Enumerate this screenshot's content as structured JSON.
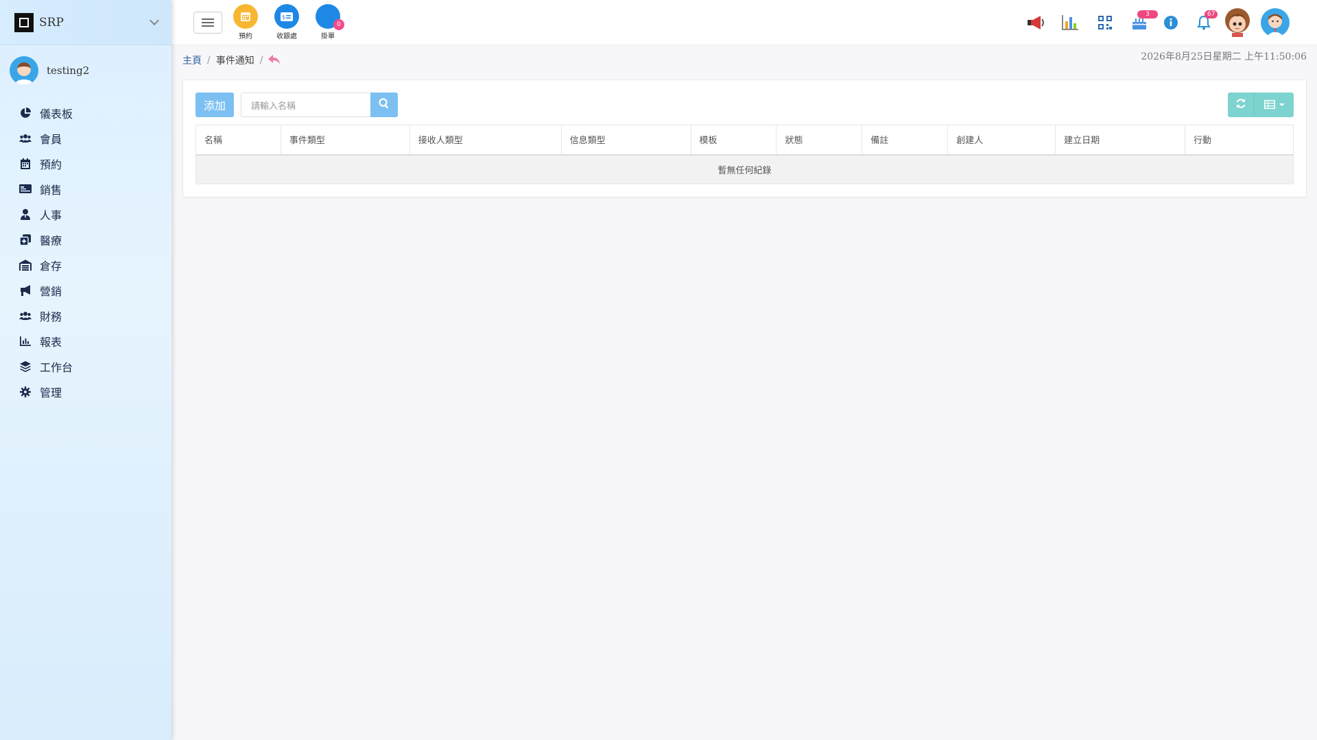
{
  "app": {
    "brand": "SRP"
  },
  "user": {
    "name": "testing2"
  },
  "sidebar": {
    "items": [
      {
        "label": "儀表板",
        "icon": "pie-chart-icon"
      },
      {
        "label": "會員",
        "icon": "users-icon"
      },
      {
        "label": "預約",
        "icon": "calendar-icon"
      },
      {
        "label": "銷售",
        "icon": "id-card-icon"
      },
      {
        "label": "人事",
        "icon": "user-tie-icon"
      },
      {
        "label": "醫療",
        "icon": "medical-clone-icon"
      },
      {
        "label": "倉存",
        "icon": "warehouse-icon"
      },
      {
        "label": "營銷",
        "icon": "bullhorn-icon"
      },
      {
        "label": "財務",
        "icon": "users-icon"
      },
      {
        "label": "報表",
        "icon": "bar-chart-icon"
      },
      {
        "label": "工作台",
        "icon": "layers-icon"
      },
      {
        "label": "管理",
        "icon": "gear-icon"
      }
    ]
  },
  "topbar": {
    "quick": [
      {
        "label": "預約",
        "color": "#f7b733",
        "icon": "calendar-icon"
      },
      {
        "label": "收銀處",
        "color": "#1e88e5",
        "icon": "cashier-card-icon"
      },
      {
        "label": "掛單",
        "color": "#1e88e5",
        "icon": "hang-order-icon",
        "badge": "0"
      }
    ],
    "right_icons": [
      {
        "icon": "megaphone-icon"
      },
      {
        "icon": "bar-chart-icon"
      },
      {
        "icon": "qr-code-icon"
      },
      {
        "icon": "cake-icon",
        "badge": "3"
      },
      {
        "icon": "info-icon"
      },
      {
        "icon": "bell-icon",
        "badge": "67"
      },
      {
        "icon": "girl-avatar-icon"
      },
      {
        "icon": "user-avatar-icon"
      }
    ]
  },
  "breadcrumb": {
    "home": "主頁",
    "current": "事件通知",
    "sep": "/"
  },
  "datetime": "2026年8月25日星期二 上午11:50:06",
  "toolbar": {
    "add_label": "添加",
    "search_placeholder": "請輸入名稱"
  },
  "table": {
    "columns": [
      "名稱",
      "事件類型",
      "接收人類型",
      "信息類型",
      "模板",
      "狀態",
      "備註",
      "創建人",
      "建立日期",
      "行動"
    ],
    "empty_text": "暫無任何紀錄"
  },
  "colors": {
    "primary_button": "#7cc0f3",
    "tool_button": "#7dd3cf",
    "badge": "#f0477f",
    "brand_link": "#2e5fa0"
  }
}
